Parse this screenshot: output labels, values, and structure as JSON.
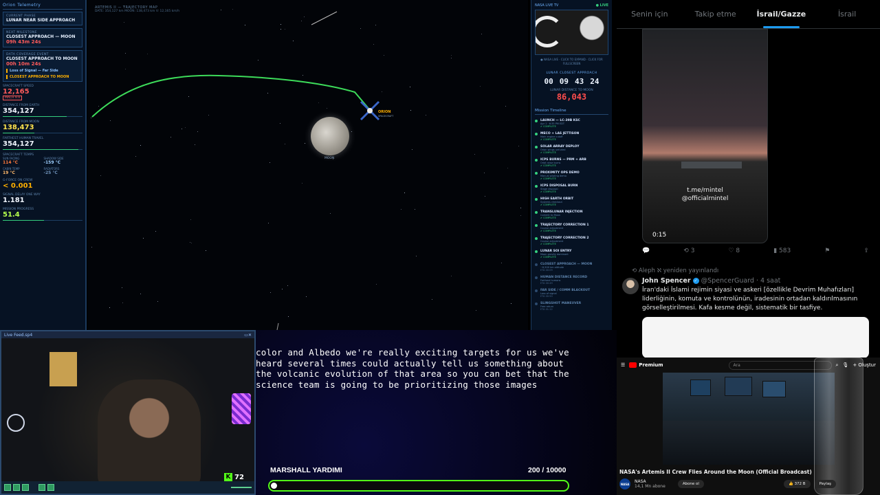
{
  "telemetry": {
    "header": "Orion Telemetry",
    "current_phase_label": "Current Phase",
    "current_phase": "LUNAR NEAR SIDE APPROACH",
    "next_milestone_label": "Next Milestone",
    "next_milestone": "CLOSEST APPROACH — MOON",
    "next_countdown": "09h 43m 24s",
    "data_coverage_label": "Data Coverage Event",
    "data_coverage": "CLOSEST APPROACH TO MOON",
    "coverage_countdown": "00h 10m 24s",
    "event_1": "Loss of Signal — Far Side",
    "event_2": "CLOSEST APPROACH TO MOON",
    "speed_label": "Spacecraft Speed",
    "speed": "12,165",
    "speed_extra": "MACH 9.9",
    "dist_earth_label": "Distance from Earth",
    "dist_earth": "354,127",
    "dist_moon_label": "Distance from Moon",
    "dist_moon": "138,473",
    "farthest_label": "Farthest Human Travel",
    "farthest": "354,127",
    "thermal_label": "Spacecraft Temps",
    "temp_sun_label": "Sun Facing",
    "temp_sun": "114 °C",
    "temp_shadow_label": "Shadow Side",
    "temp_shadow": "-159 °C",
    "temp_cabin_label": "Cabin Temp",
    "temp_cabin": "19 °C",
    "temp_radiator_label": "Radiators",
    "temp_radiator": "-25 °C",
    "gforce_label": "G-Force on Crew",
    "gforce": "< 0.001",
    "delay_label": "Signal Delay One Way",
    "delay": "1.181",
    "progress_label": "Mission Progress",
    "progress": "51.4"
  },
  "map": {
    "title": "ARTEMIS II — TRAJECTORY MAP",
    "info": "DATE: 354,127 km   MOON: 138,473 km   V: 12,165 km/h",
    "moon_label": "MOON",
    "orion_label": "ORION",
    "orion_sub": "SPACECRAFT"
  },
  "livetv": {
    "header": "NASA LIVE TV",
    "live": "● LIVE",
    "caption": "● NASA LIVE · CLICK TO EXPAND · CLICK FOR FULLSCREEN",
    "countdown_label": "LUNAR CLOSEST APPROACH",
    "countdown": [
      "00",
      "09",
      "43",
      "24"
    ],
    "distance_label": "LUNAR DISTANCE TO MOON",
    "distance": "86,043",
    "timeline_title": "Mission Timeline",
    "timeline": [
      {
        "name": "LAUNCH — LC-39B KSC",
        "desc": "Apr 1 · 6:35 PM EDT",
        "status": "✔ COMPLETE",
        "done": true
      },
      {
        "name": "MECO + LAS JETTISON",
        "desc": "Main engine cutoff",
        "status": "✔ COMPLETE",
        "done": true
      },
      {
        "name": "SOLAR ARRAY DEPLOY",
        "desc": "Orion wings unfurled",
        "status": "✔ COMPLETE",
        "done": true
      },
      {
        "name": "ICPS BURNS — PRM + ARB",
        "desc": "Orbit raise burns",
        "status": "✔ COMPLETE",
        "done": true
      },
      {
        "name": "PROXIMITY OPS DEMO",
        "desc": "Manual piloting demo",
        "status": "✔ COMPLETE",
        "done": true
      },
      {
        "name": "ICPS DISPOSAL BURN",
        "desc": "Stage disposal",
        "status": "✔ COMPLETE",
        "done": true
      },
      {
        "name": "HIGH EARTH ORBIT",
        "desc": "Systems checkout",
        "status": "✔ COMPLETE",
        "done": true
      },
      {
        "name": "TRANSLUNAR INJECTION",
        "desc": "Commit to Moon",
        "status": "✔ COMPLETE",
        "done": true
      },
      {
        "name": "TRAJECTORY CORRECTION 1",
        "desc": "Course adjustment",
        "status": "✔ COMPLETE",
        "done": true
      },
      {
        "name": "TRAJECTORY CORRECTION 2",
        "desc": "Course adjustment",
        "status": "✔ COMPLETE",
        "done": true
      },
      {
        "name": "LUNAR SOI ENTRY",
        "desc": "Moon gravity dominant",
        "status": "✔ COMPLETE",
        "done": true
      },
      {
        "name": "CLOSEST APPROACH — MOON",
        "desc": "~6,500 km altitude",
        "status": "ETA 00:09",
        "done": false
      },
      {
        "name": "HUMAN DISTANCE RECORD",
        "desc": "Farthest humans",
        "status": "ETA 00:49",
        "done": false
      },
      {
        "name": "FAR SIDE / COMM BLACKOUT",
        "desc": "Loss of signal",
        "status": "ETA 00:50",
        "done": false
      },
      {
        "name": "SLINGSHOT MANEUVER",
        "desc": "Free return",
        "status": "ETA 01:12",
        "done": false
      }
    ]
  },
  "twitter": {
    "tabs": [
      "Senin için",
      "Takip etme",
      "İsrail/Gazze",
      "İsrail"
    ],
    "active_tab": 2,
    "video_text_1": "t.me/rnintel",
    "video_text_2": "@officialrnintel",
    "video_time": "0:15",
    "reply_count": "",
    "repost_count": "3",
    "like_count": "8",
    "view_count": "583",
    "repost_line": "Aleph ℵ yeniden yayınlandı",
    "author_name": "John Spencer",
    "author_handle": "@SpencerGuard",
    "time": "· 4 saat",
    "text": "İran'daki İslami rejimin siyasi ve askeri [özellikle Devrim Muhafızları] liderliğinin, komuta ve kontrolünün, iradesinin ortadan kaldırılmasının görselleştirilmesi. Kafa kesme değil, sistematik bir tasfiye."
  },
  "youtube": {
    "logo": "Premium",
    "search_placeholder": "Ara",
    "create": "+ Oluştur",
    "title": "NASA's Artemis II Crew Flies Around the Moon (Official Broadcast)",
    "channel": "NASA",
    "subs": "14,1 Mn abone",
    "subscribe": "Abone ol",
    "likes": "372 B",
    "share": "Paylaş"
  },
  "webcam": {
    "title": "Live Feed.sp4",
    "kick_count": "72"
  },
  "captions": {
    "text": "color and Albedo we're really exciting targets for us we've\nheard several times could actually tell us something about\nthe volcanic evolution of that area so you can bet that the\nscience team is going to be prioritizing those images"
  },
  "goal": {
    "label": "MARSHALL YARDIMI",
    "current": "200",
    "target": "10000",
    "count_text": "200 / 10000",
    "progress": 0.02
  },
  "colors": {
    "trajectory": "#3ddc5a",
    "kick_green": "#53fc18",
    "alert_red": "#ff4d4d",
    "twitter_blue": "#1d9bf0"
  }
}
